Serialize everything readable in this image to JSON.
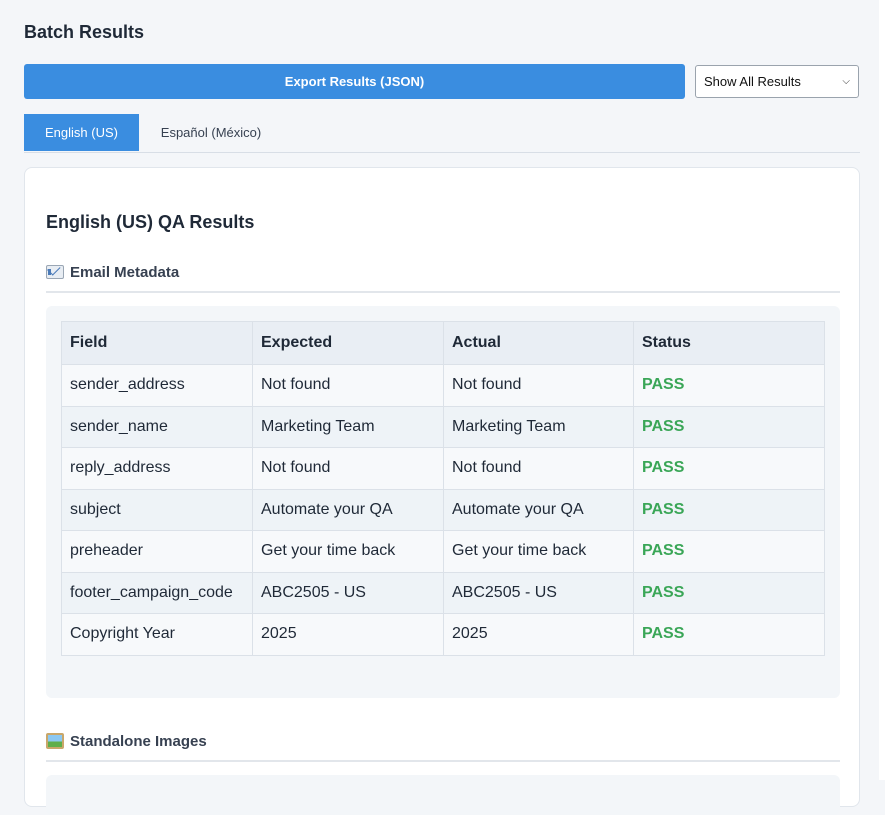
{
  "header": {
    "title": "Batch Results"
  },
  "toolbar": {
    "export_label": "Export Results (JSON)",
    "filter_selected": "Show All Results"
  },
  "tabs": [
    {
      "label": "English (US)",
      "active": true
    },
    {
      "label": "Español (México)",
      "active": false
    }
  ],
  "section": {
    "title": "English (US) QA Results",
    "metadata_heading": "Email Metadata",
    "metadata_icon": "envelope-icon",
    "images_heading": "Standalone Images",
    "images_icon": "framed-picture-icon"
  },
  "table": {
    "headers": [
      "Field",
      "Expected",
      "Actual",
      "Status"
    ],
    "rows": [
      [
        "sender_address",
        "Not found",
        "Not found",
        "PASS"
      ],
      [
        "sender_name",
        "Marketing Team",
        "Marketing Team",
        "PASS"
      ],
      [
        "reply_address",
        "Not found",
        "Not found",
        "PASS"
      ],
      [
        "subject",
        "Automate your QA",
        "Automate your QA",
        "PASS"
      ],
      [
        "preheader",
        "Get your time back",
        "Get your time back",
        "PASS"
      ],
      [
        "footer_campaign_code",
        "ABC2505 - US",
        "ABC2505 - US",
        "PASS"
      ],
      [
        "Copyright Year",
        "2025",
        "2025",
        "PASS"
      ]
    ]
  },
  "colors": {
    "accent": "#3a8de0",
    "pass": "#3aa657"
  }
}
